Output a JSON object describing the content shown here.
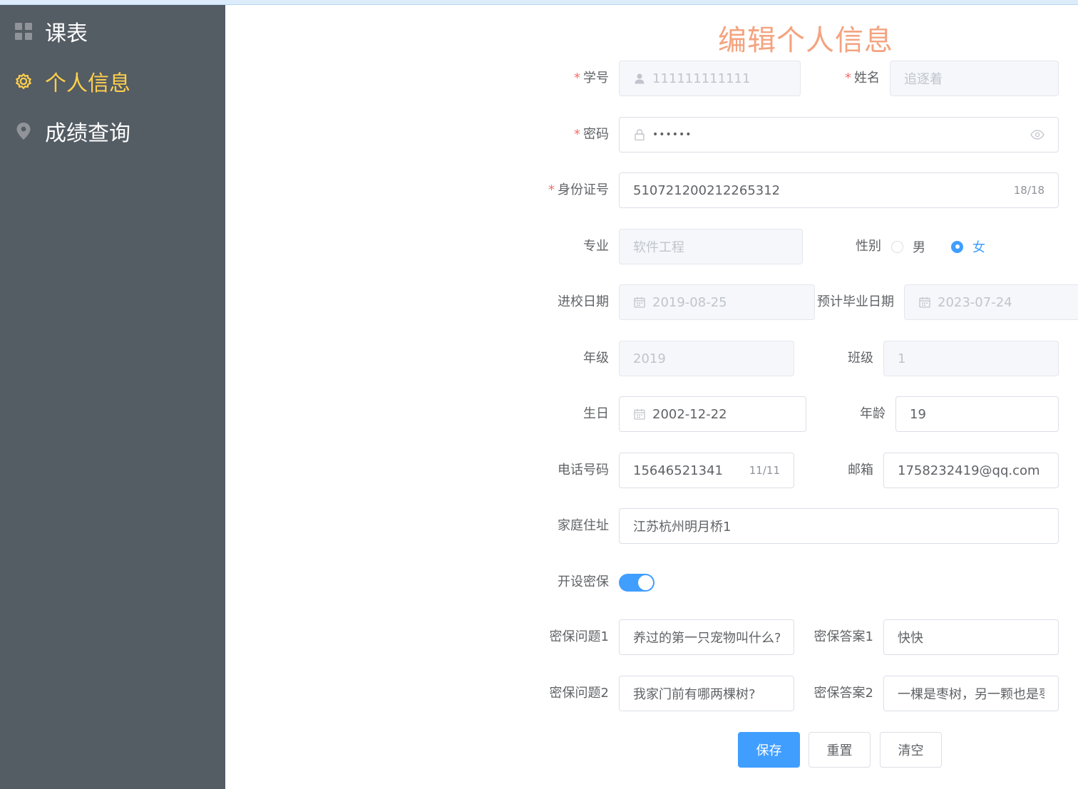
{
  "sidebar": {
    "items": [
      {
        "label": "课表",
        "icon": "grid-icon"
      },
      {
        "label": "个人信息",
        "icon": "gear-icon",
        "active": true
      },
      {
        "label": "成绩查询",
        "icon": "location-pin-icon"
      }
    ]
  },
  "page_title": "编辑个人信息",
  "form": {
    "student_id": {
      "label": "学号",
      "value": "111111111111"
    },
    "name": {
      "label": "姓名",
      "placeholder": "追逐着"
    },
    "password": {
      "label": "密码",
      "value": "••••••"
    },
    "id_number": {
      "label": "身份证号",
      "value": "510721200212265312",
      "counter": "18/18"
    },
    "major": {
      "label": "专业",
      "placeholder": "软件工程"
    },
    "gender": {
      "label": "性别",
      "options": [
        "男",
        "女"
      ],
      "selected": "女"
    },
    "enroll_date": {
      "label": "进校日期",
      "value": "2019-08-25"
    },
    "grad_date": {
      "label": "预计毕业日期",
      "value": "2023-07-24"
    },
    "grade": {
      "label": "年级",
      "value": "2019"
    },
    "class": {
      "label": "班级",
      "value": "1"
    },
    "birthday": {
      "label": "生日",
      "value": "2002-12-22"
    },
    "age": {
      "label": "年龄",
      "value": "19"
    },
    "phone": {
      "label": "电话号码",
      "value": "15646521341",
      "counter": "11/11"
    },
    "email": {
      "label": "邮箱",
      "value": "1758232419@qq.com"
    },
    "address": {
      "label": "家庭住址",
      "value": "江苏杭州明月桥1"
    },
    "security": {
      "label": "开设密保",
      "enabled": true
    },
    "q1": {
      "label": "密保问题1",
      "value": "养过的第一只宠物叫什么?"
    },
    "a1": {
      "label": "密保答案1",
      "value": "快快"
    },
    "q2": {
      "label": "密保问题2",
      "value": "我家门前有哪两棵树?"
    },
    "a2": {
      "label": "密保答案2",
      "value": "一棵是枣树，另一颗也是枣树"
    }
  },
  "buttons": {
    "save": "保存",
    "reset": "重置",
    "clear": "清空"
  },
  "colors": {
    "sidebar_bg": "#545c64",
    "active": "#ffd04b",
    "primary": "#409eff",
    "title": "#f4a37f",
    "required": "#f56c6c"
  }
}
